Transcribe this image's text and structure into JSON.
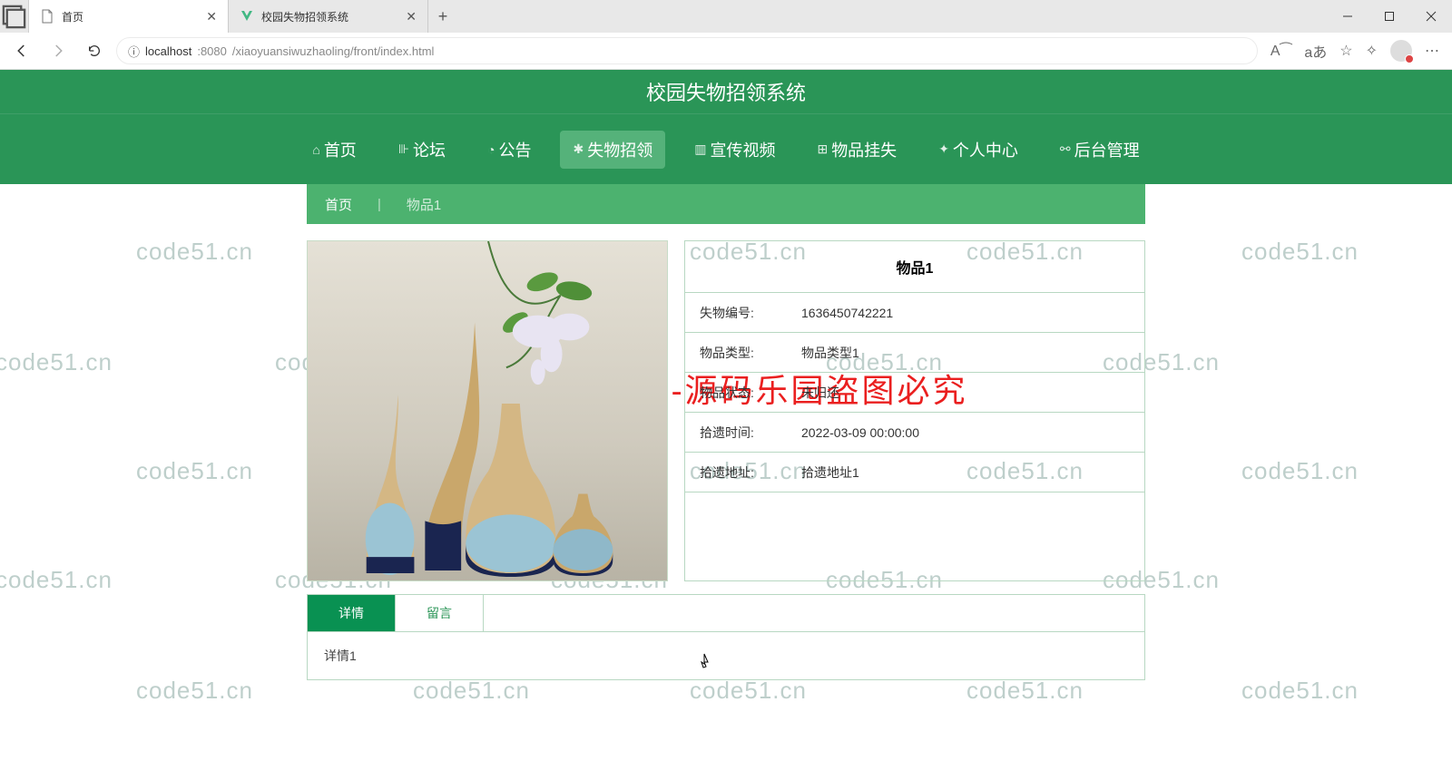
{
  "browser": {
    "tabs": [
      {
        "title": "首页",
        "favicon": "page"
      },
      {
        "title": "校园失物招领系统",
        "favicon": "vue"
      }
    ],
    "url_host": "localhost",
    "url_port": ":8080",
    "url_path": "/xiaoyuansiwuzhaoling/front/index.html",
    "url_info_icon": "ⓘ"
  },
  "site_title": "校园失物招领系统",
  "nav": [
    {
      "label": "首页"
    },
    {
      "label": "论坛"
    },
    {
      "label": "公告"
    },
    {
      "label": "失物招领",
      "active": true
    },
    {
      "label": "宣传视频"
    },
    {
      "label": "物品挂失"
    },
    {
      "label": "个人中心"
    },
    {
      "label": "后台管理"
    }
  ],
  "breadcrumb": {
    "home": "首页",
    "current": "物品1"
  },
  "item": {
    "title": "物品1",
    "rows": [
      {
        "label": "失物编号:",
        "value": "1636450742221"
      },
      {
        "label": "物品类型:",
        "value": "物品类型1"
      },
      {
        "label": "物品状态:",
        "value": "未归还"
      },
      {
        "label": "拾遗时间:",
        "value": "2022-03-09 00:00:00"
      },
      {
        "label": "拾遗地址:",
        "value": "拾遗地址1"
      }
    ]
  },
  "tabs_panel": {
    "tabs": [
      "详情",
      "留言"
    ],
    "content": "详情1"
  },
  "watermark": {
    "text": "code51.cn",
    "banner": "code51. cn-源码乐园盗图必究"
  }
}
